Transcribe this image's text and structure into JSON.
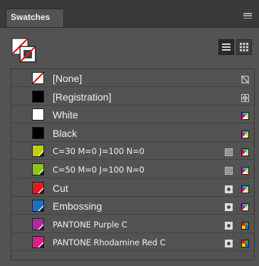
{
  "panel": {
    "tab_label": "Swatches"
  },
  "swatches": [
    {
      "label": "[None]",
      "color": "#ffffff",
      "chip": "none",
      "mode_icon": "none-disabled-icon"
    },
    {
      "label": "[Registration]",
      "color": "#000000",
      "chip": "solid",
      "mode_icon": "registration-icon"
    },
    {
      "label": "White",
      "color": "#ffffff",
      "chip": "solid",
      "mode_icon": "cmyk-icon"
    },
    {
      "label": "Black",
      "color": "#000000",
      "chip": "solid",
      "mode_icon": "cmyk-icon"
    },
    {
      "label": "C=30 M=0 J=100 N=0",
      "color": "#c2d200",
      "chip": "solid",
      "type_icon": "process-icon",
      "mode_icon": "cmyk-icon"
    },
    {
      "label": "C=50 M=0 J=100 N=0",
      "color": "#8dc21f",
      "chip": "solid",
      "type_icon": "process-icon",
      "mode_icon": "cmyk-icon"
    },
    {
      "label": "Cut",
      "color": "#e8191e",
      "chip": "solid",
      "type_icon": "spot-icon",
      "mode_icon": "cmyk-icon"
    },
    {
      "label": "Embossing",
      "color": "#1e6fc2",
      "chip": "solid",
      "type_icon": "spot-icon",
      "mode_icon": "cmyk-icon"
    },
    {
      "label": "PANTONE Purple C",
      "color": "#b3299b",
      "chip": "solid",
      "type_icon": "spot-icon",
      "mode_icon": "rgb-icon"
    },
    {
      "label": "PANTONE Rhodamine Red C",
      "color": "#e01a87",
      "chip": "solid",
      "type_icon": "spot-icon",
      "mode_icon": "rgb-icon"
    }
  ]
}
